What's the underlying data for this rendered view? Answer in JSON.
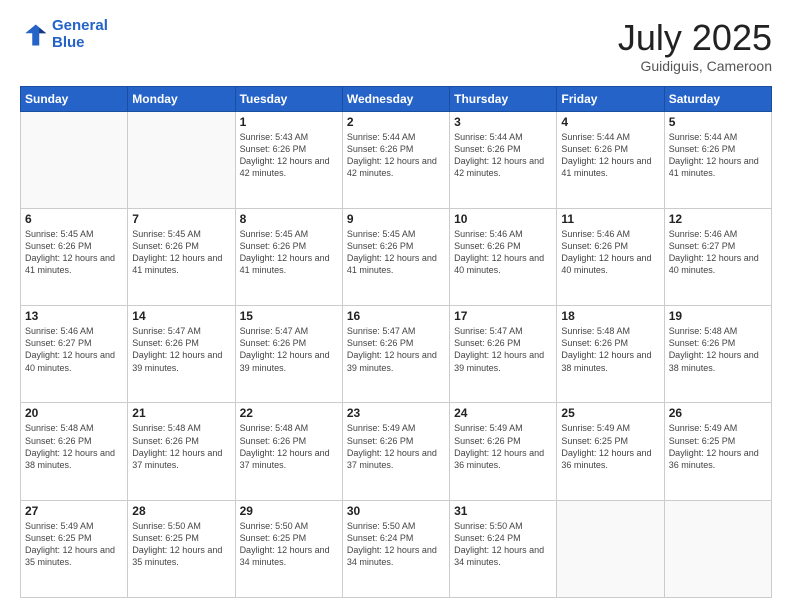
{
  "logo": {
    "line1": "General",
    "line2": "Blue"
  },
  "title": "July 2025",
  "subtitle": "Guidiguis, Cameroon",
  "weekdays": [
    "Sunday",
    "Monday",
    "Tuesday",
    "Wednesday",
    "Thursday",
    "Friday",
    "Saturday"
  ],
  "weeks": [
    [
      {
        "day": "",
        "sunrise": "",
        "sunset": "",
        "daylight": ""
      },
      {
        "day": "",
        "sunrise": "",
        "sunset": "",
        "daylight": ""
      },
      {
        "day": "1",
        "sunrise": "Sunrise: 5:43 AM",
        "sunset": "Sunset: 6:26 PM",
        "daylight": "Daylight: 12 hours and 42 minutes."
      },
      {
        "day": "2",
        "sunrise": "Sunrise: 5:44 AM",
        "sunset": "Sunset: 6:26 PM",
        "daylight": "Daylight: 12 hours and 42 minutes."
      },
      {
        "day": "3",
        "sunrise": "Sunrise: 5:44 AM",
        "sunset": "Sunset: 6:26 PM",
        "daylight": "Daylight: 12 hours and 42 minutes."
      },
      {
        "day": "4",
        "sunrise": "Sunrise: 5:44 AM",
        "sunset": "Sunset: 6:26 PM",
        "daylight": "Daylight: 12 hours and 41 minutes."
      },
      {
        "day": "5",
        "sunrise": "Sunrise: 5:44 AM",
        "sunset": "Sunset: 6:26 PM",
        "daylight": "Daylight: 12 hours and 41 minutes."
      }
    ],
    [
      {
        "day": "6",
        "sunrise": "Sunrise: 5:45 AM",
        "sunset": "Sunset: 6:26 PM",
        "daylight": "Daylight: 12 hours and 41 minutes."
      },
      {
        "day": "7",
        "sunrise": "Sunrise: 5:45 AM",
        "sunset": "Sunset: 6:26 PM",
        "daylight": "Daylight: 12 hours and 41 minutes."
      },
      {
        "day": "8",
        "sunrise": "Sunrise: 5:45 AM",
        "sunset": "Sunset: 6:26 PM",
        "daylight": "Daylight: 12 hours and 41 minutes."
      },
      {
        "day": "9",
        "sunrise": "Sunrise: 5:45 AM",
        "sunset": "Sunset: 6:26 PM",
        "daylight": "Daylight: 12 hours and 41 minutes."
      },
      {
        "day": "10",
        "sunrise": "Sunrise: 5:46 AM",
        "sunset": "Sunset: 6:26 PM",
        "daylight": "Daylight: 12 hours and 40 minutes."
      },
      {
        "day": "11",
        "sunrise": "Sunrise: 5:46 AM",
        "sunset": "Sunset: 6:26 PM",
        "daylight": "Daylight: 12 hours and 40 minutes."
      },
      {
        "day": "12",
        "sunrise": "Sunrise: 5:46 AM",
        "sunset": "Sunset: 6:27 PM",
        "daylight": "Daylight: 12 hours and 40 minutes."
      }
    ],
    [
      {
        "day": "13",
        "sunrise": "Sunrise: 5:46 AM",
        "sunset": "Sunset: 6:27 PM",
        "daylight": "Daylight: 12 hours and 40 minutes."
      },
      {
        "day": "14",
        "sunrise": "Sunrise: 5:47 AM",
        "sunset": "Sunset: 6:26 PM",
        "daylight": "Daylight: 12 hours and 39 minutes."
      },
      {
        "day": "15",
        "sunrise": "Sunrise: 5:47 AM",
        "sunset": "Sunset: 6:26 PM",
        "daylight": "Daylight: 12 hours and 39 minutes."
      },
      {
        "day": "16",
        "sunrise": "Sunrise: 5:47 AM",
        "sunset": "Sunset: 6:26 PM",
        "daylight": "Daylight: 12 hours and 39 minutes."
      },
      {
        "day": "17",
        "sunrise": "Sunrise: 5:47 AM",
        "sunset": "Sunset: 6:26 PM",
        "daylight": "Daylight: 12 hours and 39 minutes."
      },
      {
        "day": "18",
        "sunrise": "Sunrise: 5:48 AM",
        "sunset": "Sunset: 6:26 PM",
        "daylight": "Daylight: 12 hours and 38 minutes."
      },
      {
        "day": "19",
        "sunrise": "Sunrise: 5:48 AM",
        "sunset": "Sunset: 6:26 PM",
        "daylight": "Daylight: 12 hours and 38 minutes."
      }
    ],
    [
      {
        "day": "20",
        "sunrise": "Sunrise: 5:48 AM",
        "sunset": "Sunset: 6:26 PM",
        "daylight": "Daylight: 12 hours and 38 minutes."
      },
      {
        "day": "21",
        "sunrise": "Sunrise: 5:48 AM",
        "sunset": "Sunset: 6:26 PM",
        "daylight": "Daylight: 12 hours and 37 minutes."
      },
      {
        "day": "22",
        "sunrise": "Sunrise: 5:48 AM",
        "sunset": "Sunset: 6:26 PM",
        "daylight": "Daylight: 12 hours and 37 minutes."
      },
      {
        "day": "23",
        "sunrise": "Sunrise: 5:49 AM",
        "sunset": "Sunset: 6:26 PM",
        "daylight": "Daylight: 12 hours and 37 minutes."
      },
      {
        "day": "24",
        "sunrise": "Sunrise: 5:49 AM",
        "sunset": "Sunset: 6:26 PM",
        "daylight": "Daylight: 12 hours and 36 minutes."
      },
      {
        "day": "25",
        "sunrise": "Sunrise: 5:49 AM",
        "sunset": "Sunset: 6:25 PM",
        "daylight": "Daylight: 12 hours and 36 minutes."
      },
      {
        "day": "26",
        "sunrise": "Sunrise: 5:49 AM",
        "sunset": "Sunset: 6:25 PM",
        "daylight": "Daylight: 12 hours and 36 minutes."
      }
    ],
    [
      {
        "day": "27",
        "sunrise": "Sunrise: 5:49 AM",
        "sunset": "Sunset: 6:25 PM",
        "daylight": "Daylight: 12 hours and 35 minutes."
      },
      {
        "day": "28",
        "sunrise": "Sunrise: 5:50 AM",
        "sunset": "Sunset: 6:25 PM",
        "daylight": "Daylight: 12 hours and 35 minutes."
      },
      {
        "day": "29",
        "sunrise": "Sunrise: 5:50 AM",
        "sunset": "Sunset: 6:25 PM",
        "daylight": "Daylight: 12 hours and 34 minutes."
      },
      {
        "day": "30",
        "sunrise": "Sunrise: 5:50 AM",
        "sunset": "Sunset: 6:24 PM",
        "daylight": "Daylight: 12 hours and 34 minutes."
      },
      {
        "day": "31",
        "sunrise": "Sunrise: 5:50 AM",
        "sunset": "Sunset: 6:24 PM",
        "daylight": "Daylight: 12 hours and 34 minutes."
      },
      {
        "day": "",
        "sunrise": "",
        "sunset": "",
        "daylight": ""
      },
      {
        "day": "",
        "sunrise": "",
        "sunset": "",
        "daylight": ""
      }
    ]
  ]
}
